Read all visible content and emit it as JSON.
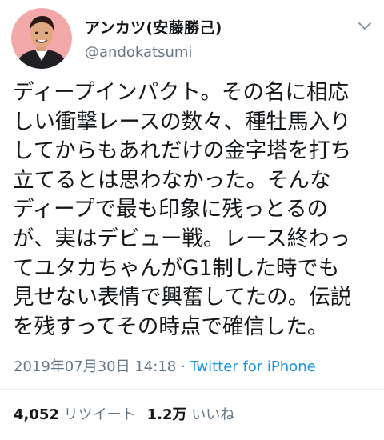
{
  "author": {
    "display_name": "アンカツ(安藤勝己)",
    "handle": "@andokatsumi",
    "avatar_icon": "profile-photo"
  },
  "menu_icon": "chevron-down-icon",
  "tweet": {
    "lines": [
      "ディープインパクト。その名に相応",
      "しい衝撃レースの数々、種牡馬入り",
      "してからもあれだけの金字塔を打ち",
      "立てるとは思わなかった。そんな",
      "ディープで最も印象に残っとるの",
      "が、実はデビュー戦。レース終わっ",
      "てユタカちゃんがG1制した時でも",
      "見せない表情で興奮してたの。伝説",
      "を残すってその時点で確信した。"
    ],
    "timestamp": "2019年07月30日 14:18",
    "separator": " · ",
    "source": "Twitter for iPhone"
  },
  "stats": {
    "retweets_count": "4,052",
    "retweets_label": "リツイート",
    "likes_count": "1.2万",
    "likes_label": "いいね"
  },
  "colors": {
    "text": "#14171a",
    "secondary": "#657786",
    "link": "#1b95e0",
    "avatar_bg": "#f2a7a7"
  }
}
